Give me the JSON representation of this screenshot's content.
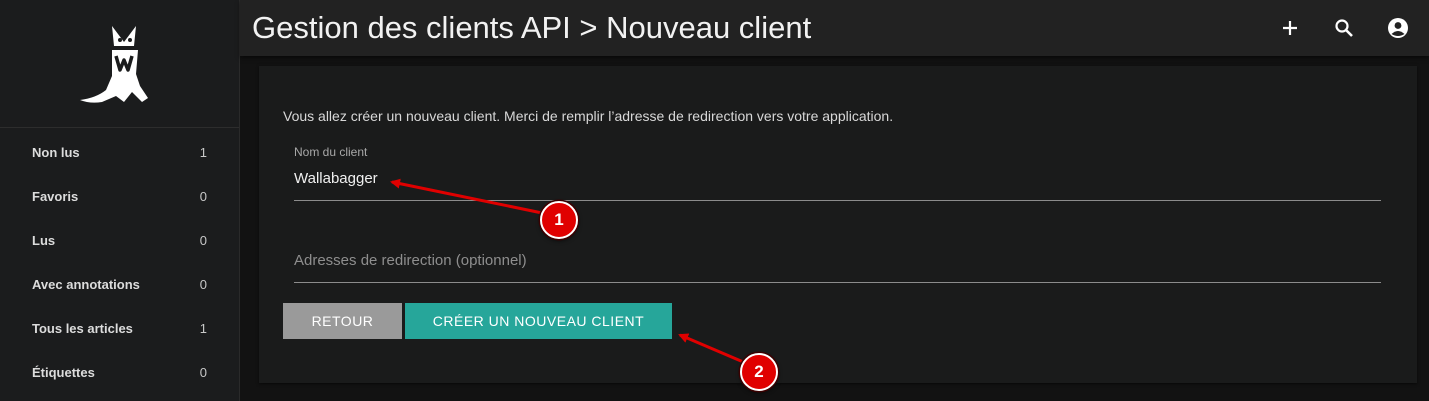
{
  "header": {
    "title": "Gestion des clients API > Nouveau client",
    "icons": [
      "add-icon",
      "search-icon",
      "account-icon"
    ]
  },
  "sidebar": {
    "items": [
      {
        "label": "Non lus",
        "count": "1"
      },
      {
        "label": "Favoris",
        "count": "0"
      },
      {
        "label": "Lus",
        "count": "0"
      },
      {
        "label": "Avec annotations",
        "count": "0"
      },
      {
        "label": "Tous les articles",
        "count": "1"
      },
      {
        "label": "Étiquettes",
        "count": "0"
      }
    ]
  },
  "form": {
    "intro": "Vous allez créer un nouveau client. Merci de remplir l’adresse de redirection vers votre application.",
    "client_name_label": "Nom du client",
    "client_name_value": "Wallabagger",
    "redirect_placeholder": "Adresses de redirection (optionnel)",
    "back_label": "RETOUR",
    "create_label": "CRÉER UN NOUVEAU CLIENT"
  },
  "annotations": {
    "badge_1": "1",
    "badge_2": "2",
    "color": "#e00000"
  },
  "colors": {
    "accent": "#26a69a",
    "back_button": "#9a9a9a",
    "background": "#121212"
  }
}
